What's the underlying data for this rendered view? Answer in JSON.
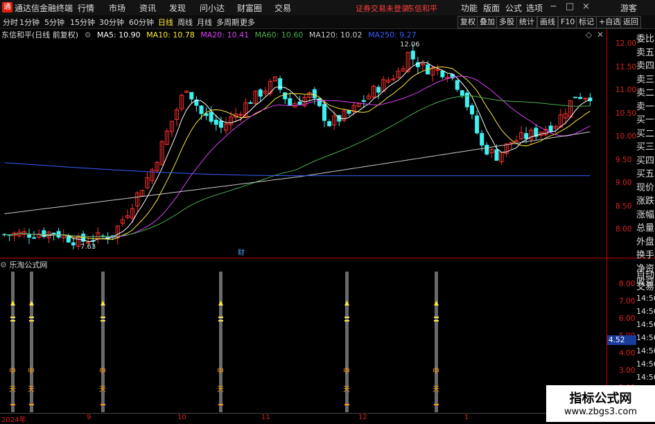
{
  "app": {
    "title": "通达信金融终端",
    "menu": [
      "行情",
      "市场",
      "资讯",
      "发现",
      "问小达",
      "财富圈",
      "交易"
    ],
    "status_text": "证券交易未登录",
    "stock_name": "东信和平",
    "right_menu": [
      "功能",
      "版面",
      "公式",
      "选项"
    ],
    "guest": "游客",
    "window_controls": [
      "−",
      "□",
      "×"
    ]
  },
  "toolbar": {
    "periods": [
      "分时",
      "1分钟",
      "5分钟",
      "15分钟",
      "30分钟",
      "60分钟",
      "日线",
      "周线",
      "月线",
      "多周期",
      "更多"
    ],
    "active_period": "日线",
    "buttons": [
      "复权",
      "叠加",
      "多股",
      "统计",
      "画线",
      "F10",
      "标记",
      "+自选",
      "返回"
    ]
  },
  "ma_header": {
    "title": "东信和平(日线 前复权)",
    "items": [
      {
        "label": "MA5: 10.90",
        "color": "#ffffff"
      },
      {
        "label": "MA10: 10.78",
        "color": "#ffeb3b"
      },
      {
        "label": "MA20: 10.41",
        "color": "#e040fb"
      },
      {
        "label": "MA60: 10.60",
        "color": "#4caf50"
      },
      {
        "label": "MA120: 10.02",
        "color": "#cccccc"
      },
      {
        "label": "MA250: 9.27",
        "color": "#3a5bff"
      }
    ]
  },
  "price_axis": [
    "12.00",
    "11.50",
    "11.00",
    "10.50",
    "10.00",
    "9.50",
    "9.00",
    "8.50",
    "8.00"
  ],
  "annotations": {
    "high": "12.06",
    "low": "7.63",
    "fin": "财"
  },
  "sub_panel": {
    "title": "乐淘公式网",
    "axis": [
      "8.00",
      "7.00",
      "6.00",
      "5.00",
      "4.00",
      "3.00",
      "2.00"
    ],
    "current": "4.52",
    "signal_chars": [
      "中",
      "天"
    ]
  },
  "x_axis": [
    "2024年",
    "9",
    "10",
    "11",
    "12",
    "1"
  ],
  "right_panel": {
    "labels": [
      "委比",
      "卖五",
      "卖四",
      "卖三",
      "卖二",
      "卖一",
      "买一",
      "买二",
      "买三",
      "买四",
      "买五",
      "现价",
      "涨跌",
      "涨幅",
      "总量",
      "外盘",
      "换手",
      "净资",
      "收益",
      "自动",
      "交易"
    ],
    "times": [
      "14:56",
      "14:56",
      "14:56",
      "14:56",
      "14:56",
      "14:56",
      "14:56",
      "14:56",
      "14:56"
    ]
  },
  "watermark": {
    "line1": "指标公式网",
    "line2": "www.zbgs3.com"
  },
  "colors": {
    "up": "#ff3030",
    "down": "#3ff0f0",
    "axis": "#d22",
    "ma5": "#ffffff",
    "ma10": "#ffeb3b",
    "ma20": "#e040fb",
    "ma60": "#4caf50",
    "ma120": "#cccccc",
    "ma250": "#3a5bff"
  }
}
